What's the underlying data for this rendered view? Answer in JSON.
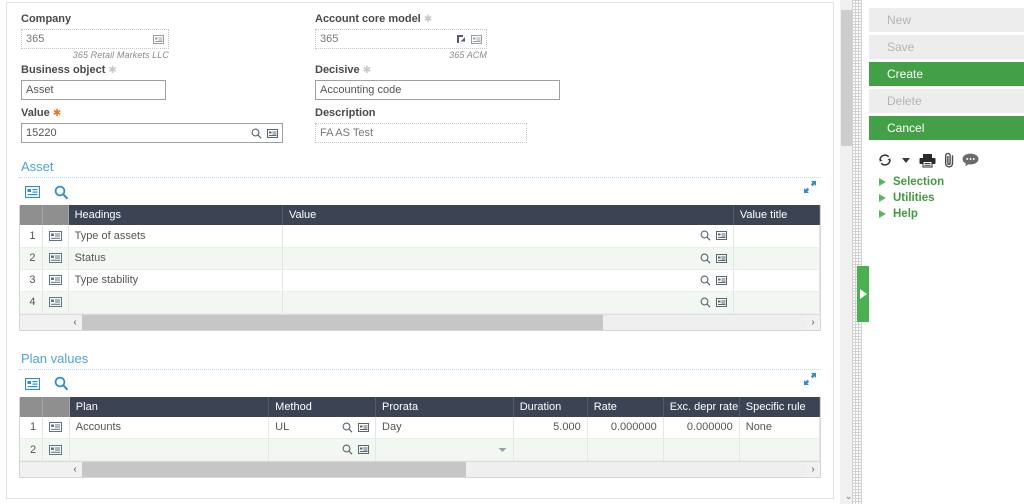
{
  "form": {
    "left": [
      {
        "label": "Company",
        "required": false,
        "optional_star": false,
        "value": "365",
        "style": "dotted",
        "adornments": [
          "card-icon"
        ],
        "note": "365 Retail Markets LLC"
      },
      {
        "label": "Business object",
        "required": false,
        "optional_star": true,
        "value": "Asset",
        "style": "solid",
        "adornments": [],
        "note": ""
      },
      {
        "label": "Value",
        "required": true,
        "optional_star": false,
        "value": "15220",
        "style": "solid",
        "adornments": [
          "search-icon",
          "card-icon"
        ],
        "note": ""
      }
    ],
    "right": [
      {
        "label": "Account core model",
        "required": false,
        "optional_star": true,
        "value": "365",
        "style": "dotted",
        "adornments": [
          "link-icon",
          "card-icon"
        ],
        "note": "365 ACM"
      },
      {
        "label": "Decisive",
        "required": false,
        "optional_star": true,
        "value": "Accounting code",
        "style": "solid",
        "adornments": [],
        "note": ""
      },
      {
        "label": "Description",
        "required": false,
        "optional_star": false,
        "value": "FA AS Test",
        "style": "dotted",
        "adornments": [],
        "note": ""
      }
    ]
  },
  "asset_section": {
    "title": "Asset",
    "toolbar": [
      "card-icon",
      "search-icon"
    ],
    "expand_icon": "expand-icon",
    "columns": [
      "Headings",
      "Value",
      "Value title"
    ],
    "rows": [
      {
        "n": "1",
        "heading": "Type of assets",
        "value": "",
        "value_title": ""
      },
      {
        "n": "2",
        "heading": "Status",
        "value": "",
        "value_title": ""
      },
      {
        "n": "3",
        "heading": "Type stability",
        "value": "",
        "value_title": ""
      },
      {
        "n": "4",
        "heading": "",
        "value": "",
        "value_title": ""
      }
    ],
    "scroll": {
      "left_arrow": "‹",
      "right_arrow": "›",
      "thumb_percent": 72
    }
  },
  "plan_section": {
    "title": "Plan values",
    "toolbar": [
      "card-icon",
      "search-icon"
    ],
    "expand_icon": "expand-icon",
    "columns": [
      "Plan",
      "Method",
      "Prorata",
      "Duration",
      "Rate",
      "Exc. depr rate",
      "Specific rule"
    ],
    "rows": [
      {
        "n": "1",
        "plan": "Accounts",
        "method": "UL",
        "prorata": "Day",
        "duration": "5.000",
        "rate": "0.000000",
        "exc_depr_rate": "0.000000",
        "specific_rule": "None"
      },
      {
        "n": "2",
        "plan": "",
        "method": "",
        "prorata": "",
        "duration": "",
        "rate": "",
        "exc_depr_rate": "",
        "specific_rule": ""
      }
    ],
    "scroll": {
      "left_arrow": "‹",
      "right_arrow": "›",
      "thumb_percent": 53
    }
  },
  "sidebar": {
    "actions": [
      {
        "label": "New",
        "state": "disabled"
      },
      {
        "label": "Save",
        "state": "disabled"
      },
      {
        "label": "Create",
        "state": "primary"
      },
      {
        "label": "Delete",
        "state": "disabled"
      },
      {
        "label": "Cancel",
        "state": "primary"
      }
    ],
    "icons": [
      "refresh-icon",
      "caret-down-icon",
      "print-icon",
      "attachment-icon",
      "comment-icon"
    ],
    "tree": [
      {
        "label": "Selection"
      },
      {
        "label": "Utilities"
      },
      {
        "label": "Help"
      }
    ],
    "tab_handle": "panel-expand-handle"
  },
  "scrollbars": {
    "vertical_bottom_glyph": "⌄"
  },
  "colors": {
    "accent_green": "#43a047",
    "tree_green": "#3f9c3f",
    "section_title_blue": "#4da3e0",
    "grid_header": "#3c4454",
    "required_star": "#f07020"
  }
}
